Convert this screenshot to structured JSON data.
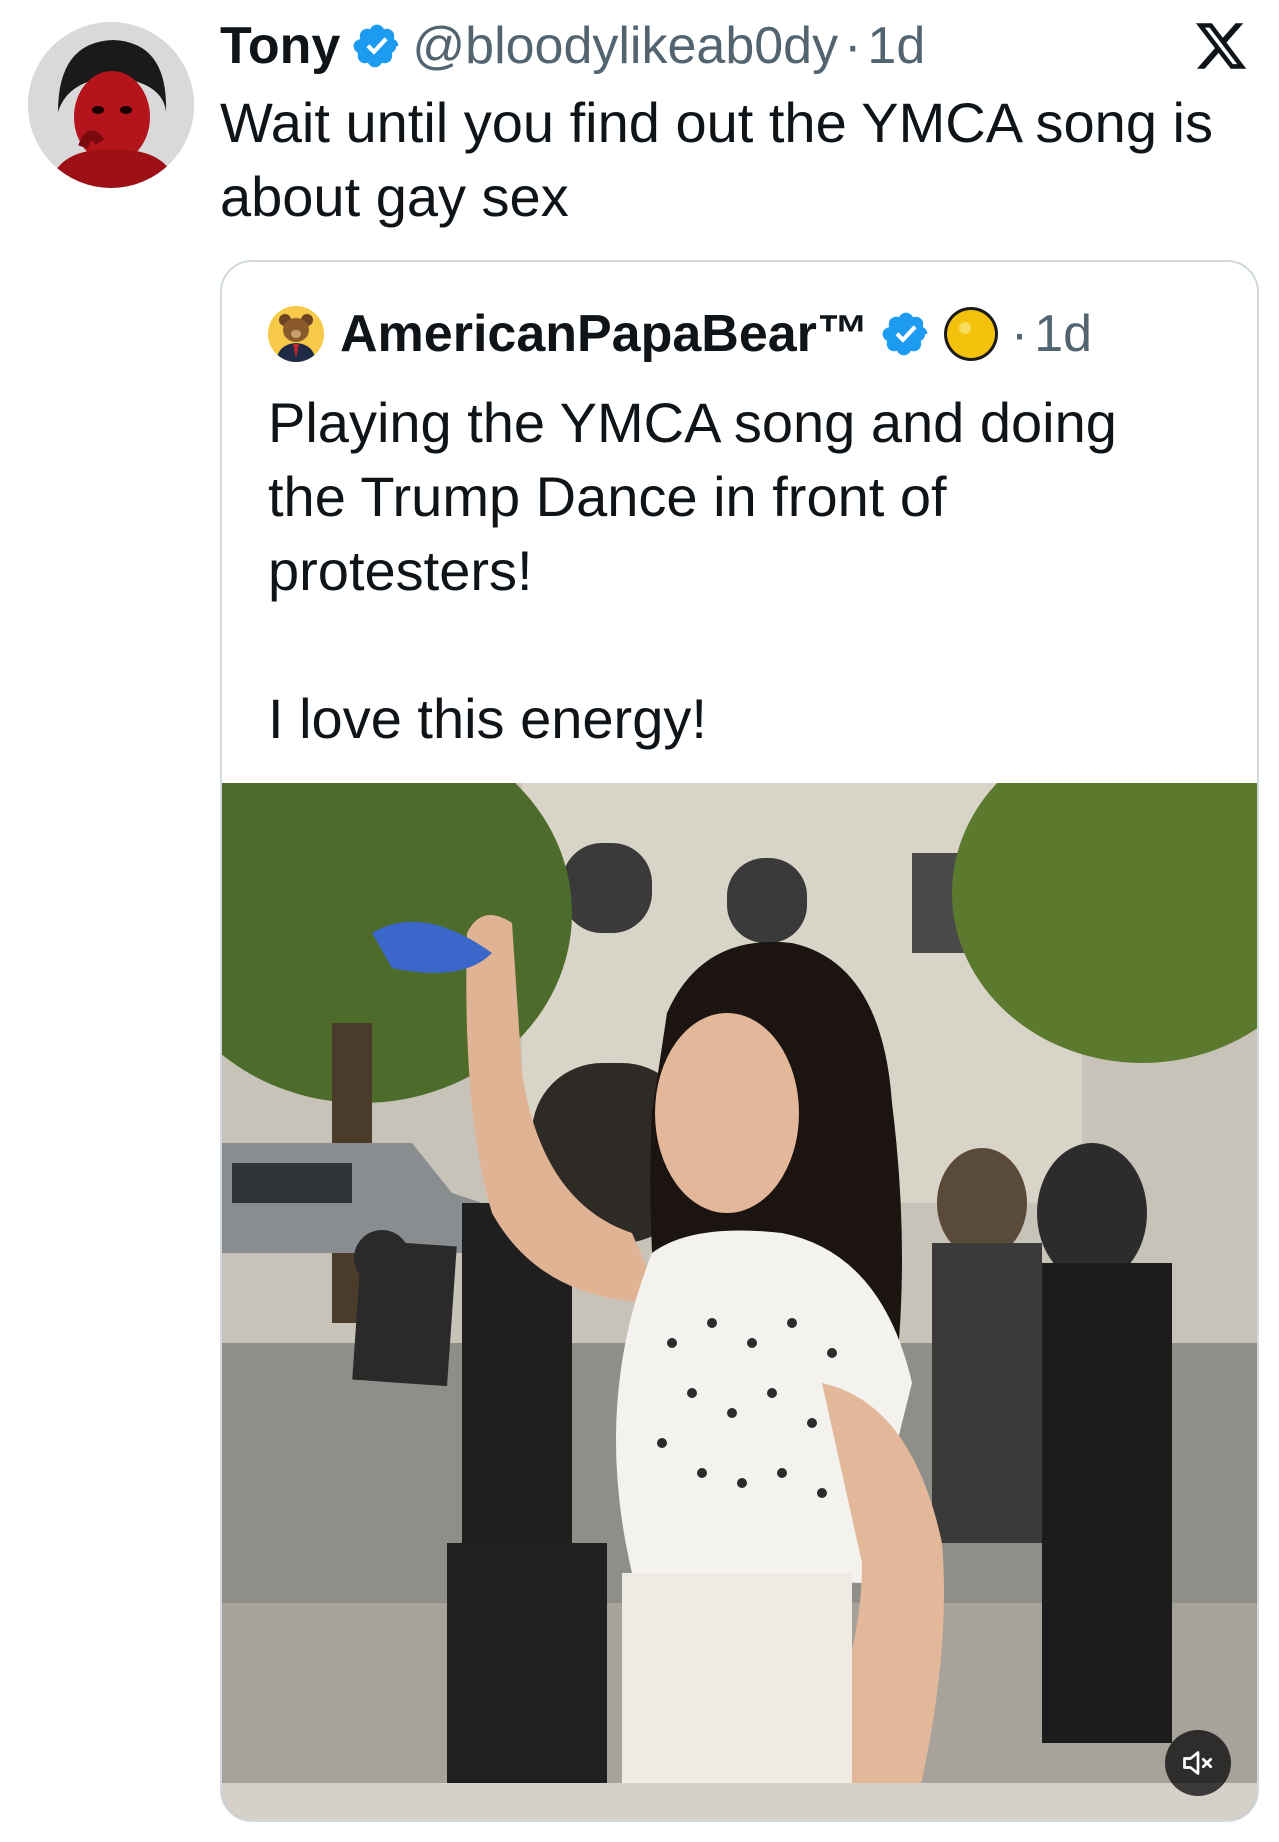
{
  "tweet": {
    "author_name": "Tony",
    "handle": "@bloodylikeab0dy",
    "separator": "·",
    "time": "1d",
    "text": "Wait until you find out the YMCA song is about gay sex",
    "avatar_icon": "face-painted-red-avatar",
    "verified_icon": "verified-badge-icon",
    "platform_icon": "x-logo-icon"
  },
  "quoted": {
    "author_name": "AmericanPapaBear™",
    "separator": "·",
    "time": "1d",
    "text": "Playing the YMCA song and doing the Trump Dance in front of protesters!\n\nI love this energy!",
    "avatar_icon": "bear-in-suit-avatar",
    "verified_icon": "verified-badge-icon",
    "emoji_icon": "yellow-moon-emoji",
    "media": {
      "type": "video",
      "mute_icon": "speaker-muted-icon"
    }
  },
  "colors": {
    "verified": "#1d9bf0",
    "secondary_text": "#536471",
    "border": "#cfd9de"
  }
}
